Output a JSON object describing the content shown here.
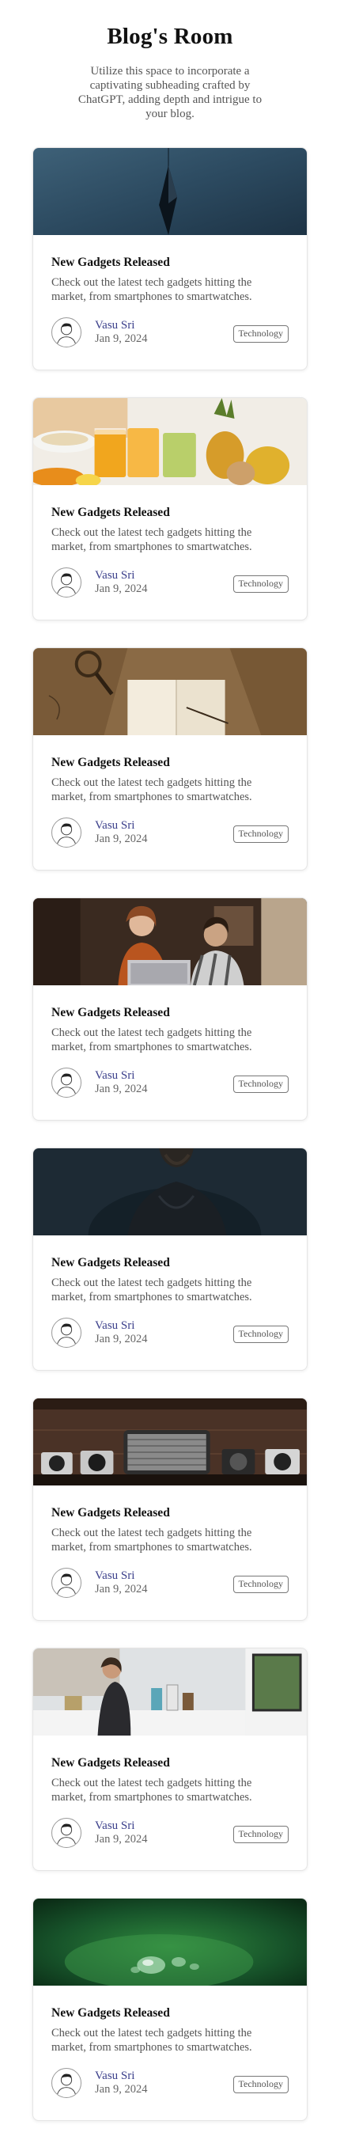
{
  "header": {
    "title": "Blog's Room",
    "subtitle": "Utilize this space to incorporate a captivating subheading crafted by ChatGPT, adding depth and intrigue to your blog."
  },
  "posts": [
    {
      "title": "New Gadgets Released",
      "description": "Check out the latest tech gadgets hitting the market, from smartphones to smartwatches.",
      "author": "Vasu Sri",
      "date": "Jan 9, 2024",
      "tag": "Technology",
      "image": "crystal-pendant-photo"
    },
    {
      "title": "New Gadgets Released",
      "description": "Check out the latest tech gadgets hitting the market, from smartphones to smartwatches.",
      "author": "Vasu Sri",
      "date": "Jan 9, 2024",
      "tag": "Technology",
      "image": "fruit-juices-photo"
    },
    {
      "title": "New Gadgets Released",
      "description": "Check out the latest tech gadgets hitting the market, from smartphones to smartwatches.",
      "author": "Vasu Sri",
      "date": "Jan 9, 2024",
      "tag": "Technology",
      "image": "map-notebook-photo"
    },
    {
      "title": "New Gadgets Released",
      "description": "Check out the latest tech gadgets hitting the market, from smartphones to smartwatches.",
      "author": "Vasu Sri",
      "date": "Jan 9, 2024",
      "tag": "Technology",
      "image": "cafe-laptop-photo"
    },
    {
      "title": "New Gadgets Released",
      "description": "Check out the latest tech gadgets hitting the market, from smartphones to smartwatches.",
      "author": "Vasu Sri",
      "date": "Jan 9, 2024",
      "tag": "Technology",
      "image": "dark-portrait-photo"
    },
    {
      "title": "New Gadgets Released",
      "description": "Check out the latest tech gadgets hitting the market, from smartphones to smartwatches.",
      "author": "Vasu Sri",
      "date": "Jan 9, 2024",
      "tag": "Technology",
      "image": "cameras-shelf-photo"
    },
    {
      "title": "New Gadgets Released",
      "description": "Check out the latest tech gadgets hitting the market, from smartphones to smartwatches.",
      "author": "Vasu Sri",
      "date": "Jan 9, 2024",
      "tag": "Technology",
      "image": "kitchen-photo"
    },
    {
      "title": "New Gadgets Released",
      "description": "Check out the latest tech gadgets hitting the market, from smartphones to smartwatches.",
      "author": "Vasu Sri",
      "date": "Jan 9, 2024",
      "tag": "Technology",
      "image": "water-drop-leaf-photo"
    }
  ],
  "colors": {
    "author_link": "#3a3e8a",
    "card_border": "#e5e5e5"
  }
}
